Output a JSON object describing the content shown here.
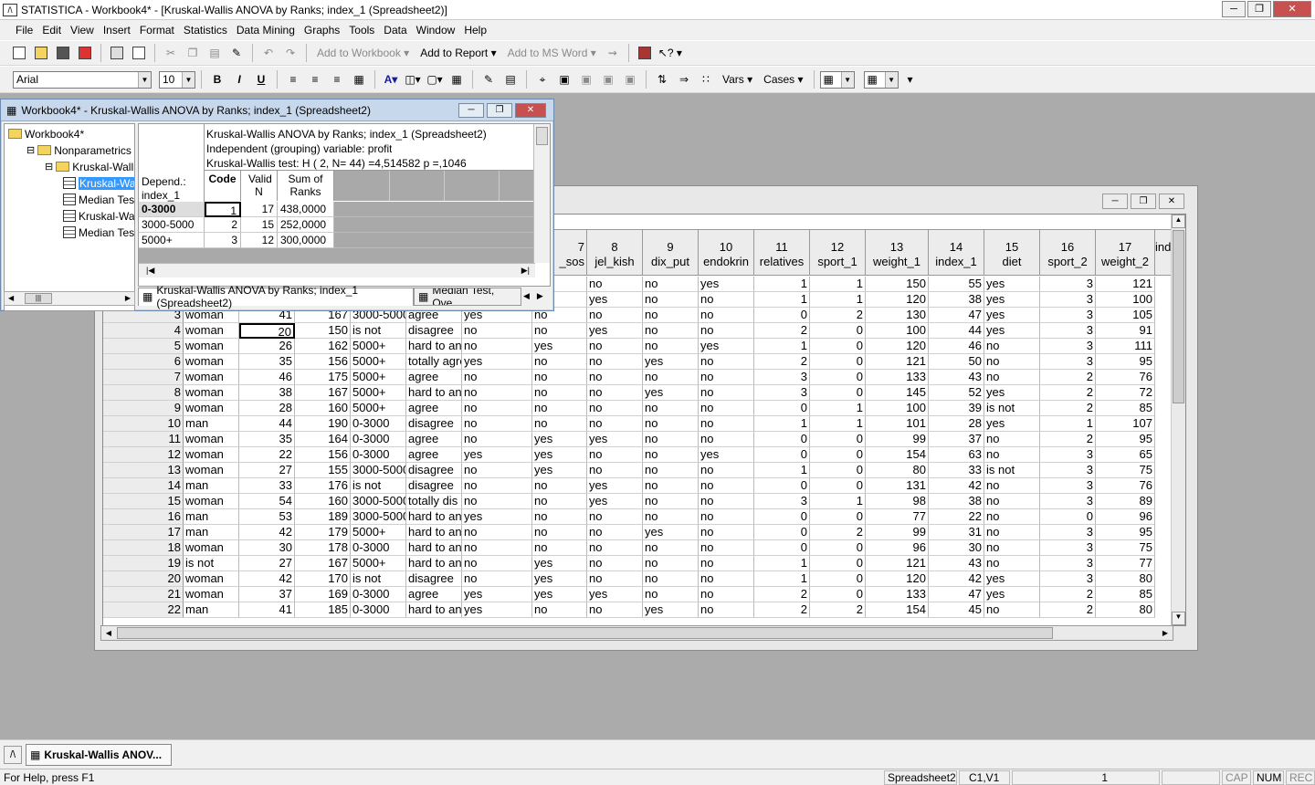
{
  "app": {
    "title": "STATISTICA - Workbook4* - [Kruskal-Wallis ANOVA by Ranks; index_1 (Spreadsheet2)]"
  },
  "menu": [
    "File",
    "Edit",
    "View",
    "Insert",
    "Format",
    "Statistics",
    "Data Mining",
    "Graphs",
    "Tools",
    "Data",
    "Window",
    "Help"
  ],
  "toolbar1": {
    "add_to_workbook": "Add to Workbook",
    "add_to_report": "Add to Report",
    "add_to_ms_word": "Add to MS Word"
  },
  "toolbar2": {
    "font": "Arial",
    "size": "10",
    "bold": "B",
    "italic": "I",
    "underline": "U",
    "vars": "Vars",
    "cases": "Cases"
  },
  "workbook": {
    "title": "Workbook4* - Kruskal-Wallis ANOVA by Ranks; index_1 (Spreadsheet2)",
    "tree": [
      {
        "label": "Workbook4*",
        "indent": 0,
        "kind": "folder"
      },
      {
        "label": "Nonparametrics (S",
        "indent": 1,
        "kind": "folder"
      },
      {
        "label": "Kruskal-Wallis A",
        "indent": 2,
        "kind": "folder"
      },
      {
        "label": "Kruskal-Wal",
        "indent": 3,
        "kind": "sheet",
        "selected": true
      },
      {
        "label": "Median Tes",
        "indent": 3,
        "kind": "sheet"
      },
      {
        "label": "Kruskal-Wal",
        "indent": 3,
        "kind": "sheet"
      },
      {
        "label": "Median Tes",
        "indent": 3,
        "kind": "sheet"
      }
    ],
    "results": {
      "header_lines": [
        "Kruskal-Wallis ANOVA by Ranks; index_1 (Spreadsheet2)",
        "Independent (grouping) variable: profit",
        "Kruskal-Wallis test: H ( 2, N= 44) =4,514582 p =,1046"
      ],
      "corner_label": "Depend.: index_1",
      "columns": [
        "Code",
        "Valid N",
        "Sum of Ranks"
      ],
      "rows": [
        {
          "label": "0-3000",
          "code": "1",
          "n": "17",
          "sum": "438,0000"
        },
        {
          "label": "3000-5000",
          "code": "2",
          "n": "15",
          "sum": "252,0000"
        },
        {
          "label": "5000+",
          "code": "3",
          "n": "12",
          "sum": "300,0000"
        }
      ]
    },
    "tabs": [
      "Kruskal-Wallis ANOVA by Ranks; index_1 (Spreadsheet2)",
      "Median Test, Ove"
    ]
  },
  "spreadsheet": {
    "columns": [
      {
        "num": "7",
        "name": "_sos"
      },
      {
        "num": "8",
        "name": "jel_kish"
      },
      {
        "num": "9",
        "name": "dix_put"
      },
      {
        "num": "10",
        "name": "endokrin"
      },
      {
        "num": "11",
        "name": "relatives"
      },
      {
        "num": "12",
        "name": "sport_1"
      },
      {
        "num": "13",
        "name": "weight_1"
      },
      {
        "num": "14",
        "name": "index_1"
      },
      {
        "num": "15",
        "name": "diet"
      },
      {
        "num": "16",
        "name": "sport_2"
      },
      {
        "num": "17",
        "name": "weight_2"
      },
      {
        "num": "",
        "name": "ind"
      }
    ],
    "rows": [
      [
        "1",
        "",
        "",
        "",
        "",
        "",
        "",
        "",
        "no",
        "no",
        "yes",
        "1",
        "1",
        "150",
        "55",
        "yes",
        "3",
        "121"
      ],
      [
        "2",
        "",
        "",
        "",
        "",
        "",
        "",
        "",
        "yes",
        "no",
        "no",
        "1",
        "1",
        "120",
        "38",
        "yes",
        "3",
        "100"
      ],
      [
        "3",
        "woman",
        "41",
        "167",
        "3000-5000",
        "agree",
        "yes",
        "no",
        "no",
        "no",
        "no",
        "0",
        "2",
        "130",
        "47",
        "yes",
        "3",
        "105"
      ],
      [
        "4",
        "woman",
        "20",
        "150",
        "is not",
        "disagree",
        "no",
        "no",
        "yes",
        "no",
        "no",
        "2",
        "0",
        "100",
        "44",
        "yes",
        "3",
        "91"
      ],
      [
        "5",
        "woman",
        "26",
        "162",
        "5000+",
        "hard to ans",
        "no",
        "yes",
        "no",
        "no",
        "yes",
        "1",
        "0",
        "120",
        "46",
        "no",
        "3",
        "111"
      ],
      [
        "6",
        "woman",
        "35",
        "156",
        "5000+",
        "totally agree",
        "yes",
        "no",
        "no",
        "yes",
        "no",
        "2",
        "0",
        "121",
        "50",
        "no",
        "3",
        "95"
      ],
      [
        "7",
        "woman",
        "46",
        "175",
        "5000+",
        "agree",
        "no",
        "no",
        "no",
        "no",
        "no",
        "3",
        "0",
        "133",
        "43",
        "no",
        "2",
        "76"
      ],
      [
        "8",
        "woman",
        "38",
        "167",
        "5000+",
        "hard to ans",
        "no",
        "no",
        "no",
        "yes",
        "no",
        "3",
        "0",
        "145",
        "52",
        "yes",
        "2",
        "72"
      ],
      [
        "9",
        "woman",
        "28",
        "160",
        "5000+",
        "agree",
        "no",
        "no",
        "no",
        "no",
        "no",
        "0",
        "1",
        "100",
        "39",
        "is not",
        "2",
        "85"
      ],
      [
        "10",
        "man",
        "44",
        "190",
        "0-3000",
        "disagree",
        "no",
        "no",
        "no",
        "no",
        "no",
        "1",
        "1",
        "101",
        "28",
        "yes",
        "1",
        "107"
      ],
      [
        "11",
        "woman",
        "35",
        "164",
        "0-3000",
        "agree",
        "no",
        "yes",
        "yes",
        "no",
        "no",
        "0",
        "0",
        "99",
        "37",
        "no",
        "2",
        "95"
      ],
      [
        "12",
        "woman",
        "22",
        "156",
        "0-3000",
        "agree",
        "yes",
        "yes",
        "no",
        "no",
        "yes",
        "0",
        "0",
        "154",
        "63",
        "no",
        "3",
        "65"
      ],
      [
        "13",
        "woman",
        "27",
        "155",
        "3000-5000",
        "disagree",
        "no",
        "yes",
        "no",
        "no",
        "no",
        "1",
        "0",
        "80",
        "33",
        "is not",
        "3",
        "75"
      ],
      [
        "14",
        "man",
        "33",
        "176",
        "is not",
        "disagree",
        "no",
        "no",
        "yes",
        "no",
        "no",
        "0",
        "0",
        "131",
        "42",
        "no",
        "3",
        "76"
      ],
      [
        "15",
        "woman",
        "54",
        "160",
        "3000-5000",
        "totally dis",
        "no",
        "no",
        "yes",
        "no",
        "no",
        "3",
        "1",
        "98",
        "38",
        "no",
        "3",
        "89"
      ],
      [
        "16",
        "man",
        "53",
        "189",
        "3000-5000",
        "hard to ans",
        "yes",
        "no",
        "no",
        "no",
        "no",
        "0",
        "0",
        "77",
        "22",
        "no",
        "0",
        "96"
      ],
      [
        "17",
        "man",
        "42",
        "179",
        "5000+",
        "hard to ans",
        "no",
        "no",
        "no",
        "yes",
        "no",
        "0",
        "2",
        "99",
        "31",
        "no",
        "3",
        "95"
      ],
      [
        "18",
        "woman",
        "30",
        "178",
        "0-3000",
        "hard to ans",
        "no",
        "no",
        "no",
        "no",
        "no",
        "0",
        "0",
        "96",
        "30",
        "no",
        "3",
        "75"
      ],
      [
        "19",
        "is not",
        "27",
        "167",
        "5000+",
        "hard to ans",
        "no",
        "yes",
        "no",
        "no",
        "no",
        "1",
        "0",
        "121",
        "43",
        "no",
        "3",
        "77"
      ],
      [
        "20",
        "woman",
        "42",
        "170",
        "is not",
        "disagree",
        "no",
        "yes",
        "no",
        "no",
        "no",
        "1",
        "0",
        "120",
        "42",
        "yes",
        "3",
        "80"
      ],
      [
        "21",
        "woman",
        "37",
        "169",
        "0-3000",
        "agree",
        "yes",
        "yes",
        "yes",
        "no",
        "no",
        "2",
        "0",
        "133",
        "47",
        "yes",
        "2",
        "85"
      ],
      [
        "22",
        "man",
        "41",
        "185",
        "0-3000",
        "hard to ans",
        "yes",
        "no",
        "no",
        "yes",
        "no",
        "2",
        "2",
        "154",
        "45",
        "no",
        "2",
        "80"
      ]
    ]
  },
  "taskbar": {
    "item": "Kruskal-Wallis ANOV..."
  },
  "status": {
    "help": "For Help, press F1",
    "sheet": "Spreadsheet2",
    "cell": "C1,V1",
    "value": "1",
    "cap": "CAP",
    "num": "NUM",
    "rec": "REC"
  }
}
